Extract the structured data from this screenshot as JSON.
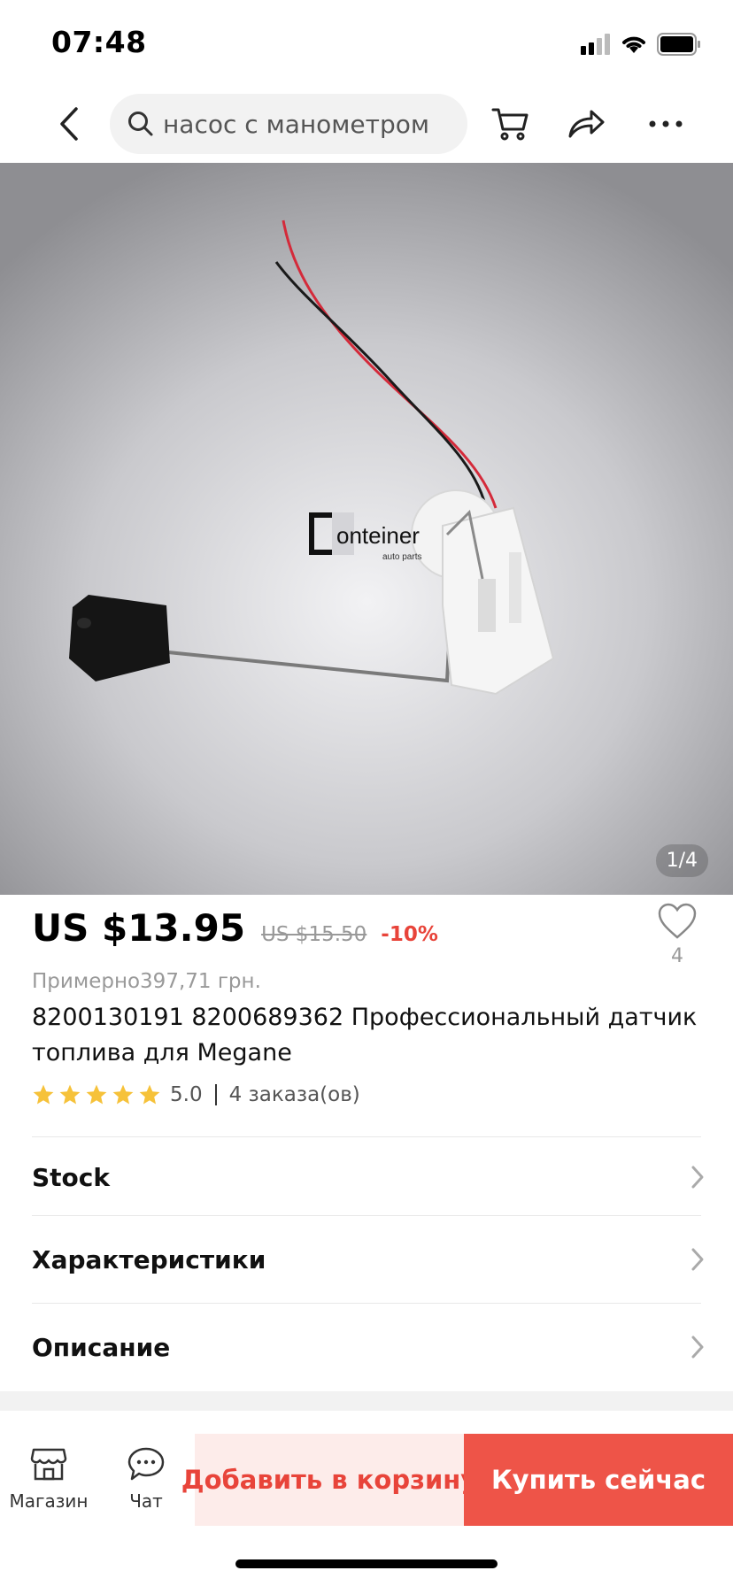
{
  "status_bar": {
    "time": "07:48"
  },
  "search": {
    "query": "насос с манометром"
  },
  "gallery": {
    "counter": "1/4",
    "watermark_brand": "onteiner",
    "watermark_sub": "auto parts"
  },
  "product": {
    "price": "US $13.95",
    "old_price": "US $15.50",
    "discount": "-10%",
    "wishlist_count": "4",
    "approx_price": "Примерно397,71 грн.",
    "title": "8200130191 8200689362 Профессиональный датчик топлива для Megane",
    "rating": "5.0",
    "rating_stars": 5,
    "orders": "4 заказа(ов)"
  },
  "sections": [
    {
      "label": "Stock"
    },
    {
      "label": "Характеристики"
    },
    {
      "label": "Описание"
    }
  ],
  "bottom_bar": {
    "store_label": "Магазин",
    "chat_label": "Чат",
    "add_to_cart": "Добавить в корзину",
    "buy_now": "Купить сейчас"
  },
  "colors": {
    "accent": "#ee5448",
    "accent_light": "#fdecea",
    "star": "#f6c23a",
    "discount": "#e8443a"
  },
  "icons": [
    "back-icon",
    "search-icon",
    "cart-icon",
    "share-icon",
    "more-icon",
    "heart-icon",
    "star-icon",
    "chevron-right-icon",
    "store-icon",
    "chat-icon",
    "signal-icon",
    "wifi-icon",
    "battery-icon"
  ]
}
